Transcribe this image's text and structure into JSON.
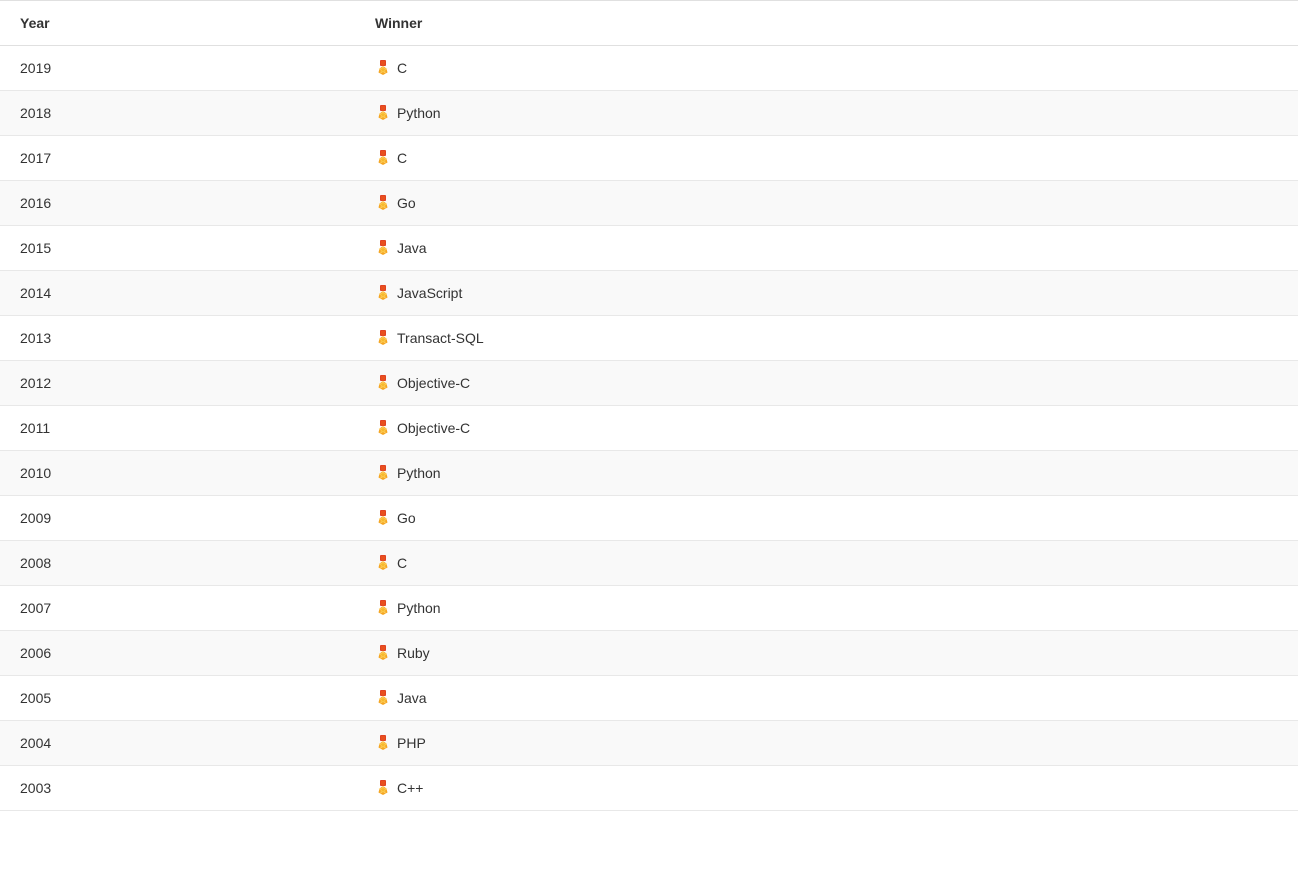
{
  "columns": {
    "year": "Year",
    "winner": "Winner"
  },
  "rows": [
    {
      "year": "2019",
      "winner": "C"
    },
    {
      "year": "2018",
      "winner": "Python"
    },
    {
      "year": "2017",
      "winner": "C"
    },
    {
      "year": "2016",
      "winner": "Go"
    },
    {
      "year": "2015",
      "winner": "Java"
    },
    {
      "year": "2014",
      "winner": "JavaScript"
    },
    {
      "year": "2013",
      "winner": "Transact-SQL"
    },
    {
      "year": "2012",
      "winner": "Objective-C"
    },
    {
      "year": "2011",
      "winner": "Objective-C"
    },
    {
      "year": "2010",
      "winner": "Python"
    },
    {
      "year": "2009",
      "winner": "Go"
    },
    {
      "year": "2008",
      "winner": "C"
    },
    {
      "year": "2007",
      "winner": "Python"
    },
    {
      "year": "2006",
      "winner": "Ruby"
    },
    {
      "year": "2005",
      "winner": "Java"
    },
    {
      "year": "2004",
      "winner": "PHP"
    },
    {
      "year": "2003",
      "winner": "C++"
    }
  ]
}
